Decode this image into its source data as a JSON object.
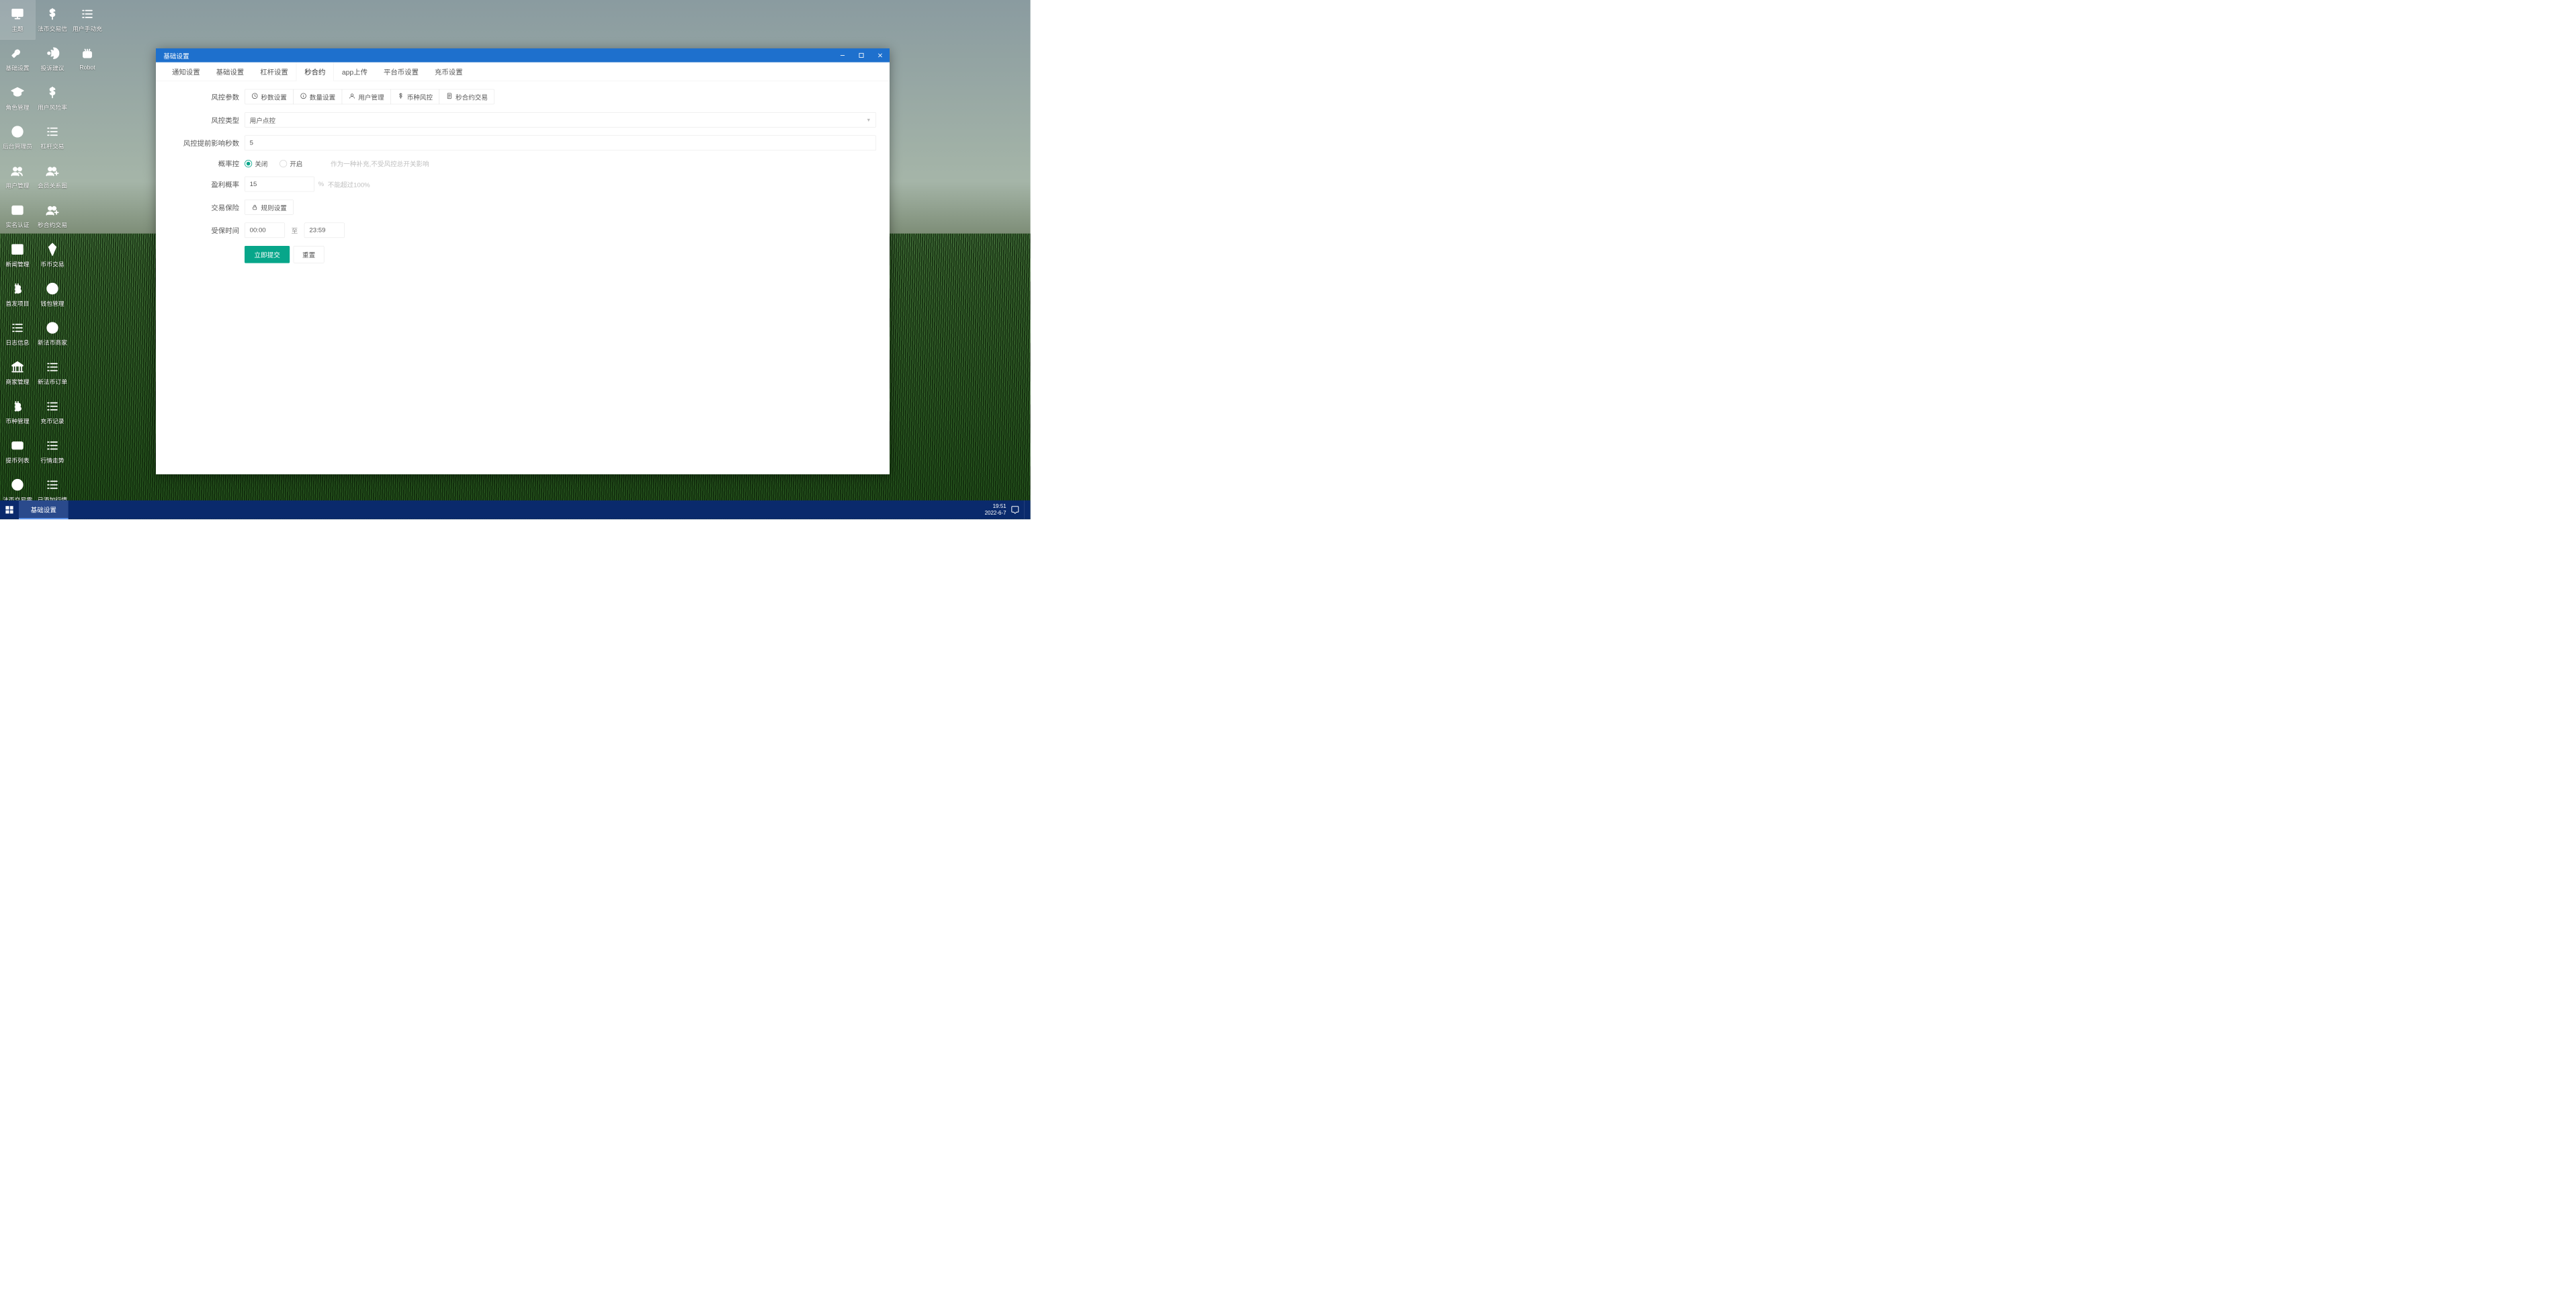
{
  "desktop": {
    "icons": [
      [
        {
          "label": "主题",
          "selected": true,
          "glyph": "monitor"
        },
        {
          "label": "基础设置",
          "glyph": "wrench"
        },
        {
          "label": "角色管理",
          "glyph": "gradcap"
        },
        {
          "label": "后台管理员",
          "glyph": "user-circle"
        },
        {
          "label": "用户管理",
          "glyph": "users"
        },
        {
          "label": "实名认证",
          "glyph": "idcard"
        },
        {
          "label": "新闻管理",
          "glyph": "newspaper"
        },
        {
          "label": "首发项目",
          "glyph": "bitcoin"
        },
        {
          "label": "日志信息",
          "glyph": "list"
        },
        {
          "label": "商家管理",
          "glyph": "bank"
        },
        {
          "label": "币种管理",
          "glyph": "bitcoin"
        },
        {
          "label": "提币列表",
          "glyph": "card"
        },
        {
          "label": "法币交易需",
          "glyph": "swap"
        }
      ],
      [
        {
          "label": "法币交易信",
          "glyph": "dollar"
        },
        {
          "label": "投诉建议",
          "glyph": "speaker"
        },
        {
          "label": "用户风险率",
          "glyph": "dollar"
        },
        {
          "label": "杠杆交易",
          "glyph": "list"
        },
        {
          "label": "会员关系图",
          "glyph": "users-plus"
        },
        {
          "label": "秒合约交易",
          "glyph": "users-plus"
        },
        {
          "label": "币币交易",
          "glyph": "diamond"
        },
        {
          "label": "钱包管理",
          "glyph": "swap"
        },
        {
          "label": "新法币商家",
          "glyph": "swap"
        },
        {
          "label": "新法币订单",
          "glyph": "list"
        },
        {
          "label": "充币记录",
          "glyph": "list"
        },
        {
          "label": "行情走势",
          "glyph": "list"
        },
        {
          "label": "已添加行情",
          "glyph": "list"
        }
      ],
      [
        {
          "label": "用户手动充",
          "glyph": "list"
        },
        {
          "label": "Robot",
          "glyph": "robot"
        }
      ]
    ]
  },
  "window": {
    "title": "基础设置",
    "tabs": [
      {
        "label": "通知设置",
        "active": false
      },
      {
        "label": "基础设置",
        "active": false
      },
      {
        "label": "杠杆设置",
        "active": false
      },
      {
        "label": "秒合约",
        "active": true
      },
      {
        "label": "app上传",
        "active": false
      },
      {
        "label": "平台币设置",
        "active": false
      },
      {
        "label": "充币设置",
        "active": false
      }
    ],
    "params_label": "风控参数",
    "param_buttons": [
      {
        "icon": "clock",
        "label": "秒数设置"
      },
      {
        "icon": "info",
        "label": "数量设置"
      },
      {
        "icon": "user",
        "label": "用户管理"
      },
      {
        "icon": "dollar",
        "label": "币种风控"
      },
      {
        "icon": "doc",
        "label": "秒合约交易"
      }
    ],
    "risk_type_label": "风控类型",
    "risk_type_value": "用户点控",
    "preseconds_label": "风控提前影响秒数",
    "preseconds_value": "5",
    "prob_label": "概率控",
    "prob_options": [
      {
        "label": "关闭",
        "checked": true
      },
      {
        "label": "开启",
        "checked": false
      }
    ],
    "prob_hint": "作为一种补充,不受风控总开关影响",
    "profit_label": "盈利概率",
    "profit_value": "15",
    "profit_unit": "%",
    "profit_hint": "不能超过100%",
    "insurance_label": "交易保险",
    "insurance_btn": "规则设置",
    "time_label": "受保时间",
    "time_from": "00:00",
    "time_to": "23:59",
    "time_sep": "至",
    "submit": "立即提交",
    "reset": "重置"
  },
  "taskbar": {
    "task": "基础设置",
    "time": "19:51",
    "date": "2022-6-7"
  }
}
